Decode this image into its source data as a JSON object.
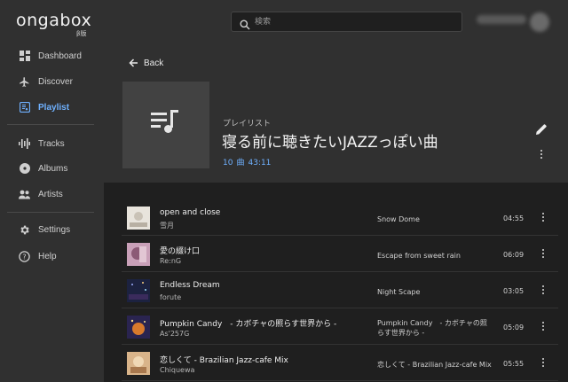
{
  "app": {
    "logo": "ongabox",
    "logo_sub": "β版"
  },
  "sidebar": {
    "items": [
      {
        "label": "Dashboard",
        "icon": "dashboard-icon",
        "active": false
      },
      {
        "label": "Discover",
        "icon": "airplane-icon",
        "active": false
      },
      {
        "label": "Playlist",
        "icon": "playlist-icon",
        "active": true
      },
      {
        "label": "Tracks",
        "icon": "waveform-icon",
        "active": false
      },
      {
        "label": "Albums",
        "icon": "disc-icon",
        "active": false
      },
      {
        "label": "Artists",
        "icon": "people-icon",
        "active": false
      },
      {
        "label": "Settings",
        "icon": "gear-icon",
        "active": false
      },
      {
        "label": "Help",
        "icon": "help-icon",
        "active": false
      }
    ]
  },
  "search": {
    "placeholder": "検索",
    "value": ""
  },
  "header": {
    "back_label": "Back",
    "kind": "プレイリスト",
    "title": "寝る前に聴きたいJAZZっぽい曲",
    "count": "10",
    "count_unit": "曲",
    "duration": "43:11"
  },
  "tracks": [
    {
      "title": "open and close",
      "artist": "雪月",
      "album": "Snow Dome",
      "duration": "04:55"
    },
    {
      "title": "愛の綴け口",
      "artist": "Re:nG",
      "album": "Escape from sweet rain",
      "duration": "06:09"
    },
    {
      "title": "Endless Dream",
      "artist": "forute",
      "album": "Night Scape",
      "duration": "03:05"
    },
    {
      "title": "Pumpkin Candy　- カボチャの照らす世界から -",
      "artist": "As'257G",
      "album": "Pumpkin Candy　- カボチャの照らす世界から -",
      "duration": "05:09"
    },
    {
      "title": "恋しくて - Brazilian Jazz-cafe Mix",
      "artist": "Chiquewa",
      "album": "恋しくて - Brazilian Jazz-cafe Mix",
      "duration": "05:55"
    }
  ],
  "colors": {
    "accent": "#6fb1ff",
    "sidebar_bg": "#303030",
    "main_bg": "#1f1f1f",
    "cover_bg": "#424242"
  }
}
